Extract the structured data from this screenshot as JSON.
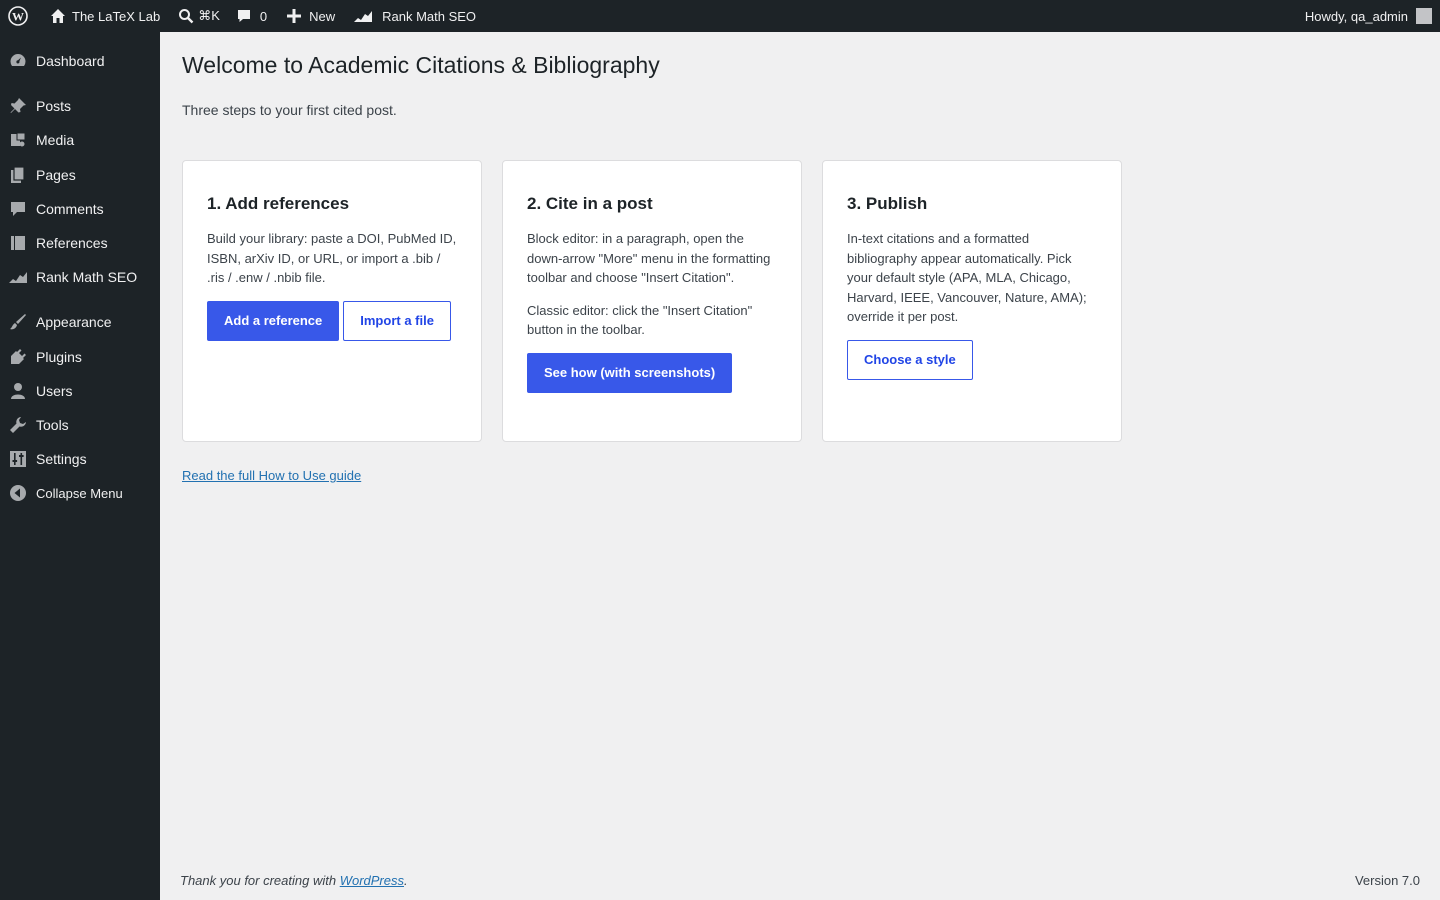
{
  "adminbar": {
    "site_name": "The LaTeX Lab",
    "search_shortcut": "⌘K",
    "comments_count": "0",
    "new_label": "New",
    "rankmath_label": "Rank Math SEO",
    "howdy": "Howdy, qa_admin"
  },
  "sidebar": {
    "items": [
      {
        "label": "Dashboard",
        "icon": "dashboard-icon"
      },
      {
        "label": "Posts",
        "icon": "pin-icon"
      },
      {
        "label": "Media",
        "icon": "media-icon"
      },
      {
        "label": "Pages",
        "icon": "pages-icon"
      },
      {
        "label": "Comments",
        "icon": "comment-icon"
      },
      {
        "label": "References",
        "icon": "book-icon"
      },
      {
        "label": "Rank Math SEO",
        "icon": "rankmath-icon"
      },
      {
        "label": "Appearance",
        "icon": "brush-icon"
      },
      {
        "label": "Plugins",
        "icon": "plug-icon"
      },
      {
        "label": "Users",
        "icon": "user-icon"
      },
      {
        "label": "Tools",
        "icon": "wrench-icon"
      },
      {
        "label": "Settings",
        "icon": "sliders-icon"
      }
    ],
    "collapse_label": "Collapse Menu"
  },
  "main": {
    "title": "Welcome to Academic Citations & Bibliography",
    "intro": "Three steps to your first cited post.",
    "cards": [
      {
        "heading": "1. Add references",
        "paragraphs": [
          "Build your library: paste a DOI, PubMed ID, ISBN, arXiv ID, or URL, or import a .bib / .ris / .enw / .nbib file."
        ],
        "primary_button": "Add a reference",
        "secondary_button": "Import a file"
      },
      {
        "heading": "2. Cite in a post",
        "paragraphs": [
          "Block editor: in a paragraph, open the down-arrow \"More\" menu in the formatting toolbar and choose \"Insert Citation\".",
          "Classic editor: click the \"Insert Citation\" button in the toolbar."
        ],
        "primary_button": "See how (with screenshots)"
      },
      {
        "heading": "3. Publish",
        "paragraphs": [
          "In-text citations and a formatted bibliography appear automatically. Pick your default style (APA, MLA, Chicago, Harvard, IEEE, Vancouver, Nature, AMA); override it per post."
        ],
        "secondary_button": "Choose a style"
      }
    ],
    "guide_link": "Read the full How to Use guide"
  },
  "footer": {
    "thanks_prefix": "Thank you for creating with ",
    "thanks_link": "WordPress",
    "thanks_suffix": ".",
    "version": "Version 7.0"
  },
  "colors": {
    "admin_bg": "#1d2327",
    "page_bg": "#f0f0f1",
    "accent": "#3858e9",
    "link": "#2271b1"
  }
}
